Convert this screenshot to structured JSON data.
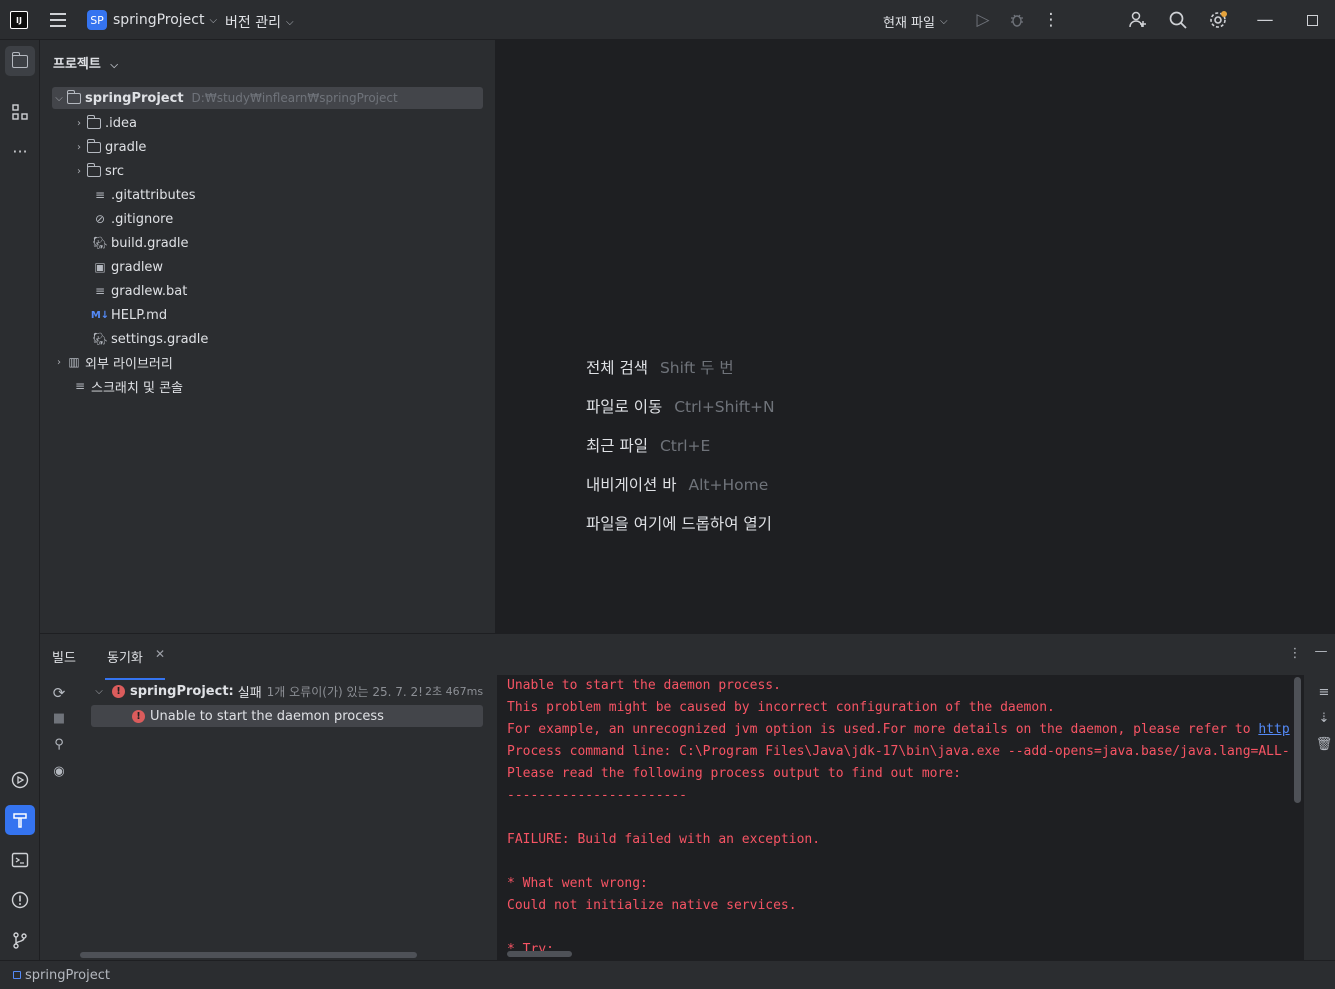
{
  "titlebar": {
    "project_badge": "SP",
    "project_name": "springProject",
    "vcs_label": "버전 관리",
    "current_file_label": "현재 파일",
    "icons": [
      "run-icon",
      "debug-icon",
      "more-icon",
      "add-user-icon",
      "search-icon",
      "settings-icon",
      "minimize-icon",
      "maximize-icon"
    ]
  },
  "left_strip": {
    "icons": [
      "project-folder-icon",
      "structure-icon",
      "more-tools-icon",
      "services-icon",
      "build-hammer-icon",
      "terminal-icon",
      "problems-icon",
      "git-icon"
    ]
  },
  "project_panel": {
    "title": "프로젝트",
    "root": {
      "name": "springProject",
      "path": "D:₩study₩inflearn₩springProject"
    },
    "items": [
      {
        "name": ".idea",
        "type": "folder"
      },
      {
        "name": "gradle",
        "type": "folder"
      },
      {
        "name": "src",
        "type": "folder"
      },
      {
        "name": ".gitattributes",
        "type": "text"
      },
      {
        "name": ".gitignore",
        "type": "ignore"
      },
      {
        "name": "build.gradle",
        "type": "gradle"
      },
      {
        "name": "gradlew",
        "type": "script"
      },
      {
        "name": "gradlew.bat",
        "type": "text"
      },
      {
        "name": "HELP.md",
        "type": "markdown"
      },
      {
        "name": "settings.gradle",
        "type": "gradle"
      }
    ],
    "external_libraries": "외부 라이브러리",
    "scratches": "스크래치 및 콘솔"
  },
  "editor": {
    "hints": [
      {
        "label": "전체 검색",
        "key": "Shift 두 번"
      },
      {
        "label": "파일로 이동",
        "key": "Ctrl+Shift+N"
      },
      {
        "label": "최근 파일",
        "key": "Ctrl+E"
      },
      {
        "label": "내비게이션 바",
        "key": "Alt+Home"
      },
      {
        "label": "파일을 여기에 드롭하여 열기",
        "key": ""
      }
    ]
  },
  "bottom": {
    "tabs": [
      "빌드",
      "동기화"
    ],
    "sync_root": {
      "name": "springProject:",
      "status": "실패",
      "detail": "1개 오류이(가) 있는 25. 7. 2!",
      "duration": "2초 467ms"
    },
    "sync_child": "Unable to start the daemon process",
    "console_lines": [
      "Unable to start the daemon process.",
      "This problem might be caused by incorrect configuration of the daemon.",
      "For example, an unrecognized jvm option is used.For more details on the daemon, please refer to ",
      "Process command line: C:\\Program Files\\Java\\jdk-17\\bin\\java.exe --add-opens=java.base/java.lang=ALL-",
      "Please read the following process output to find out more:",
      "-----------------------",
      "",
      "FAILURE: Build failed with an exception.",
      "",
      "* What went wrong:",
      "Could not initialize native services.",
      "",
      "* Try:"
    ],
    "console_link": "http"
  },
  "statusbar": {
    "project": "springProject"
  },
  "colors": {
    "accent": "#3574f0",
    "error": "#f75464",
    "background": "#1e1f22",
    "panel": "#2b2d30"
  }
}
